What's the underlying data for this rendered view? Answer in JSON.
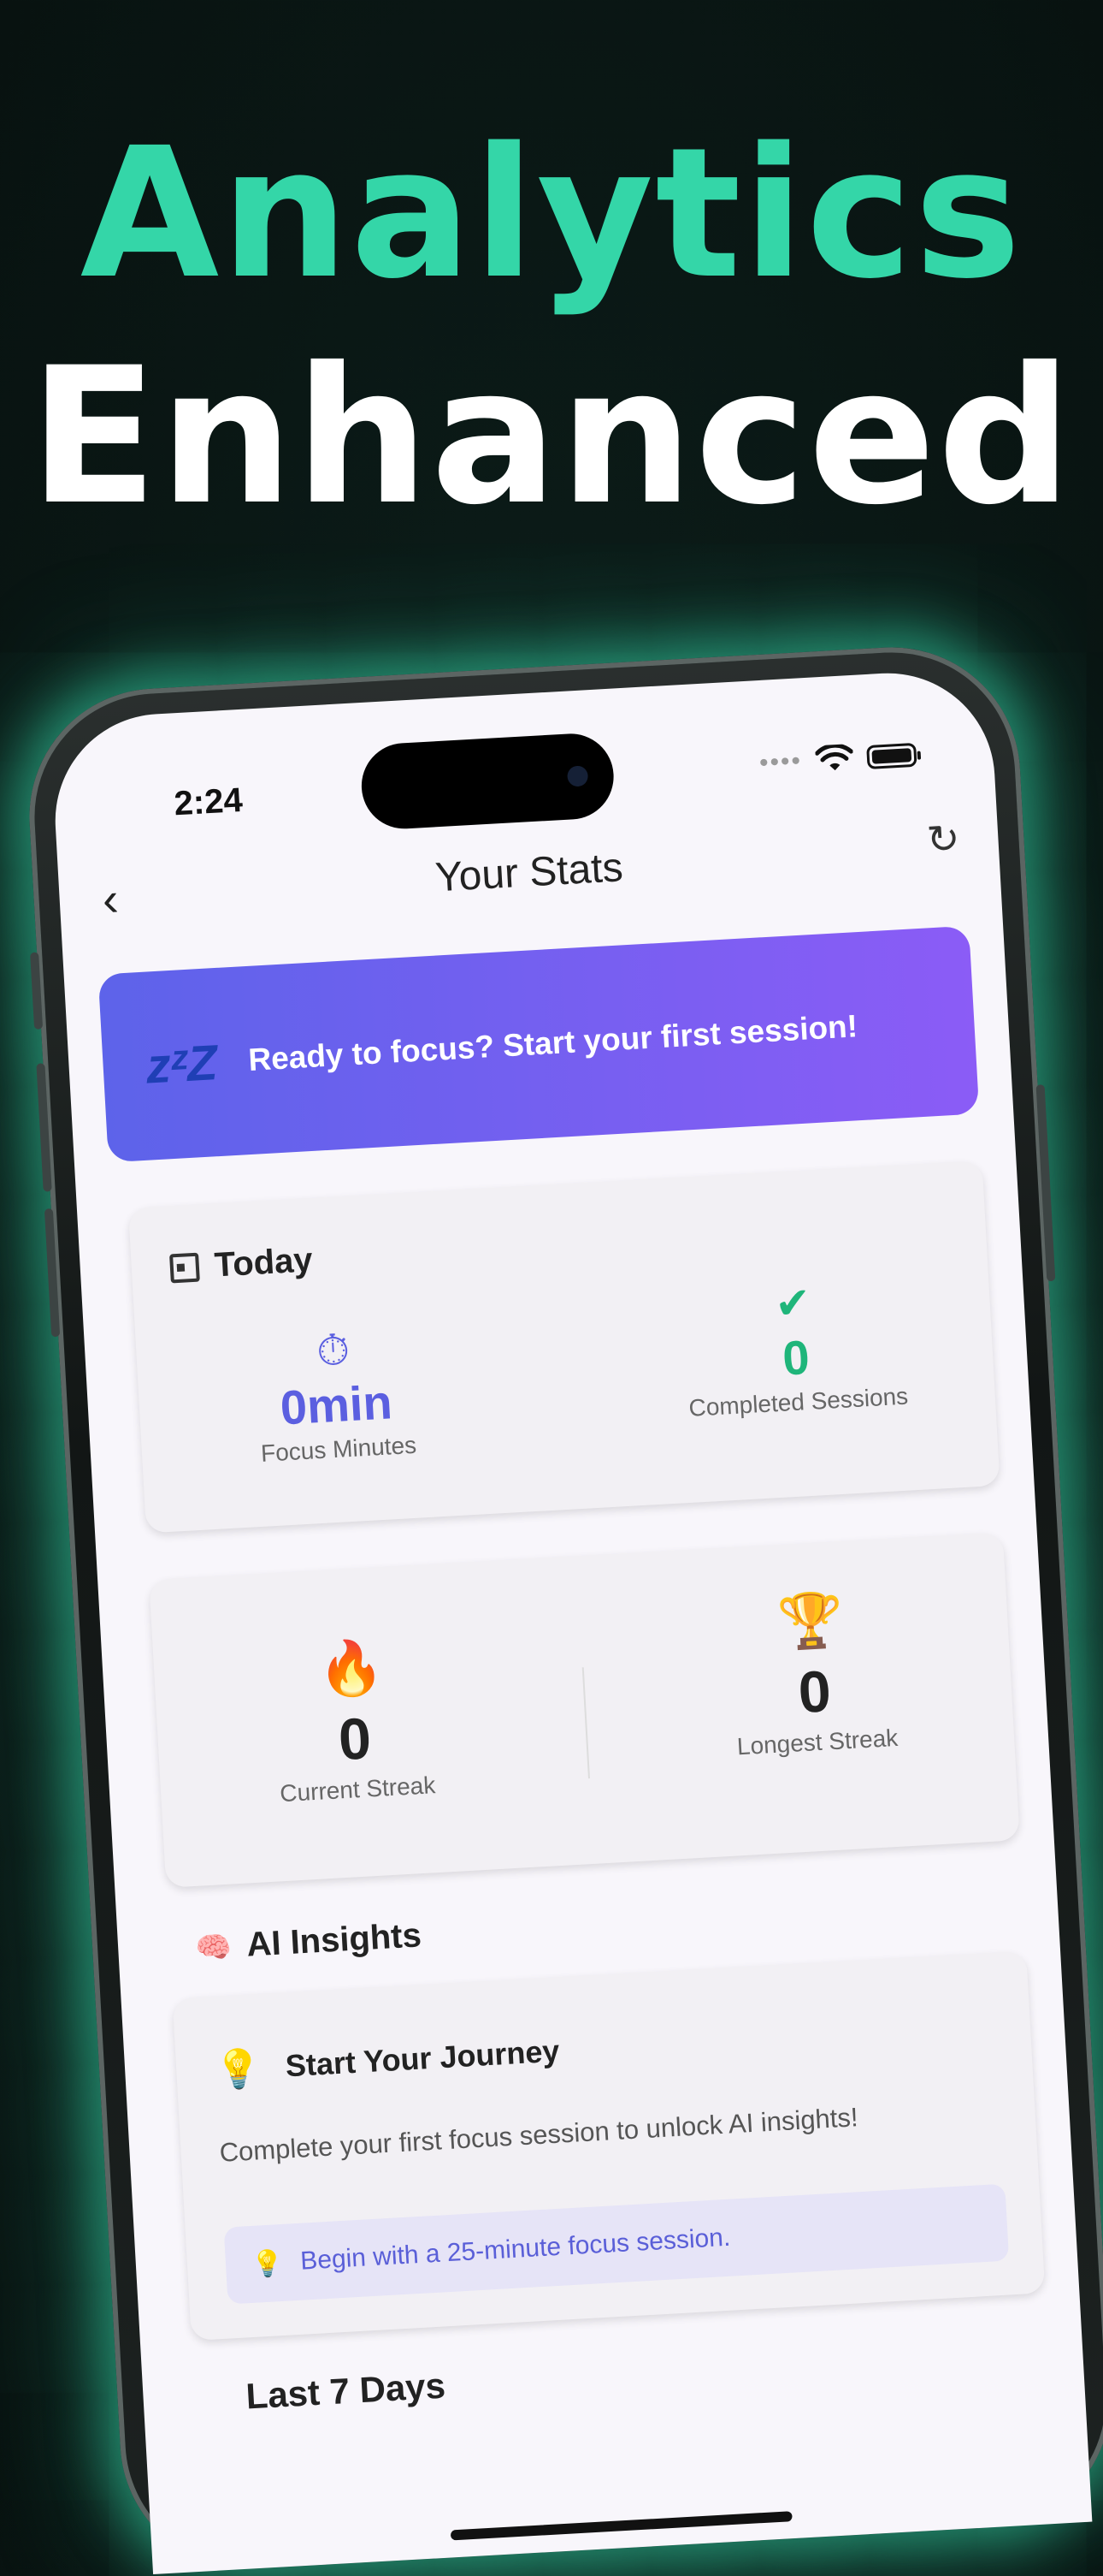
{
  "headline": {
    "line1": "Analytics",
    "line2": "Enhanced"
  },
  "status_bar": {
    "time": "2:24",
    "signal_dots": "••••"
  },
  "nav": {
    "back_icon": "‹",
    "title": "Your Stats",
    "refresh_icon": "↻"
  },
  "banner": {
    "icon": "zᶻZ",
    "text": "Ready to focus? Start your first session!"
  },
  "today": {
    "title": "Today",
    "focus": {
      "icon": "⏱",
      "value": "0min",
      "label": "Focus Minutes",
      "color": "#5b5fe0"
    },
    "sessions": {
      "icon": "✔",
      "value": "0",
      "label": "Completed Sessions",
      "color": "#1fb57a"
    }
  },
  "streaks": {
    "current": {
      "icon": "🔥",
      "value": "0",
      "label": "Current Streak"
    },
    "longest": {
      "icon": "🏆",
      "value": "0",
      "label": "Longest Streak"
    }
  },
  "ai_insights": {
    "icon": "🧠",
    "title": "AI Insights",
    "card_icon": "💡",
    "card_title": "Start Your Journey",
    "description": "Complete your first focus session to unlock AI insights!",
    "tip_icon": "💡",
    "tip": "Begin with a 25-minute focus session."
  },
  "next_section_peek": "Last 7 Days"
}
